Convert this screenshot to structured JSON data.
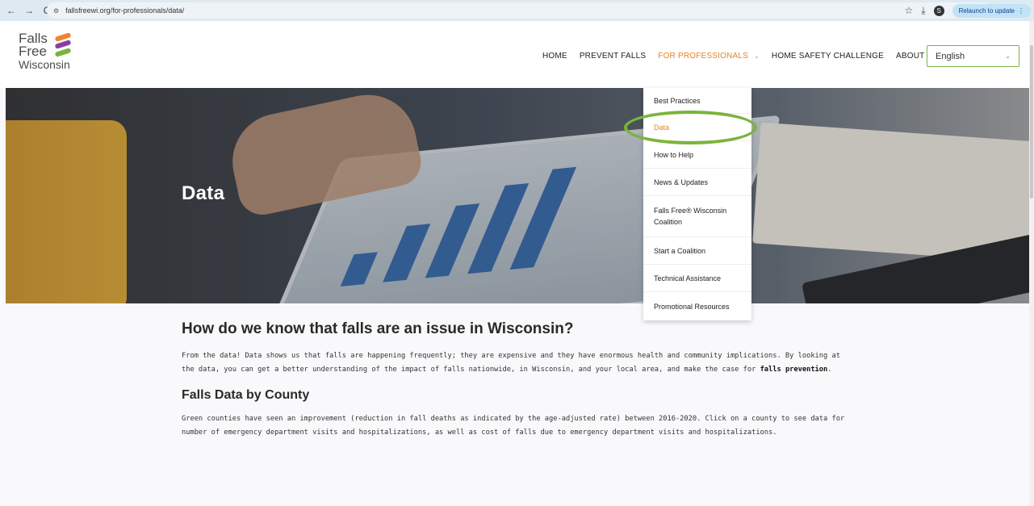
{
  "browser": {
    "back_icon": "←",
    "forward_icon": "→",
    "reload_icon": "C",
    "site_info_icon": "⚙",
    "url": "fallsfreewi.org/for-professionals/data/",
    "star_icon": "☆",
    "download_icon": "⤓",
    "profile_letter": "S",
    "relaunch_label": "Relaunch to update",
    "menu_icon": "⋮"
  },
  "header": {
    "logo_line1": "Falls",
    "logo_line2": "Free",
    "logo_line3": "Wisconsin",
    "nav": {
      "home": "HOME",
      "prevent": "PREVENT FALLS",
      "professionals": "FOR PROFESSIONALS",
      "professionals_caret": "⌄",
      "challenge": "HOME SAFETY CHALLENGE",
      "about": "ABOUT"
    },
    "search_icon": "⌕",
    "language": "English",
    "language_caret": "⌄"
  },
  "hero": {
    "title": "Data"
  },
  "dropdown": {
    "items": [
      "Best Practices",
      "Data",
      "How to Help",
      "News & Updates",
      "Falls Free® Wisconsin Coalition",
      "Start a Coalition",
      "Technical Assistance",
      "Promotional Resources"
    ],
    "active_index": 1
  },
  "content": {
    "heading": "How do we know that falls are an issue in Wisconsin?",
    "paragraph_part1": "From the data! Data shows us that falls are happening frequently; they are expensive and they have enormous health and community implications. By looking at the data, you can get a better understanding of the impact of falls nationwide, in Wisconsin, and your local area, and make the case for ",
    "paragraph_bold": "falls prevention",
    "paragraph_end": ".",
    "subheading": "Falls Data by County",
    "paragraph2": "Green counties have seen an improvement (reduction in fall deaths as indicated by the age-adjusted rate) between 2016-2020. Click on a county to see data for number of emergency department visits and hospitalizations, as well as cost of falls due to emergency department visits and hospitalizations."
  },
  "colors": {
    "accent_orange": "#e8821e",
    "highlight_green": "#7bb43a"
  }
}
